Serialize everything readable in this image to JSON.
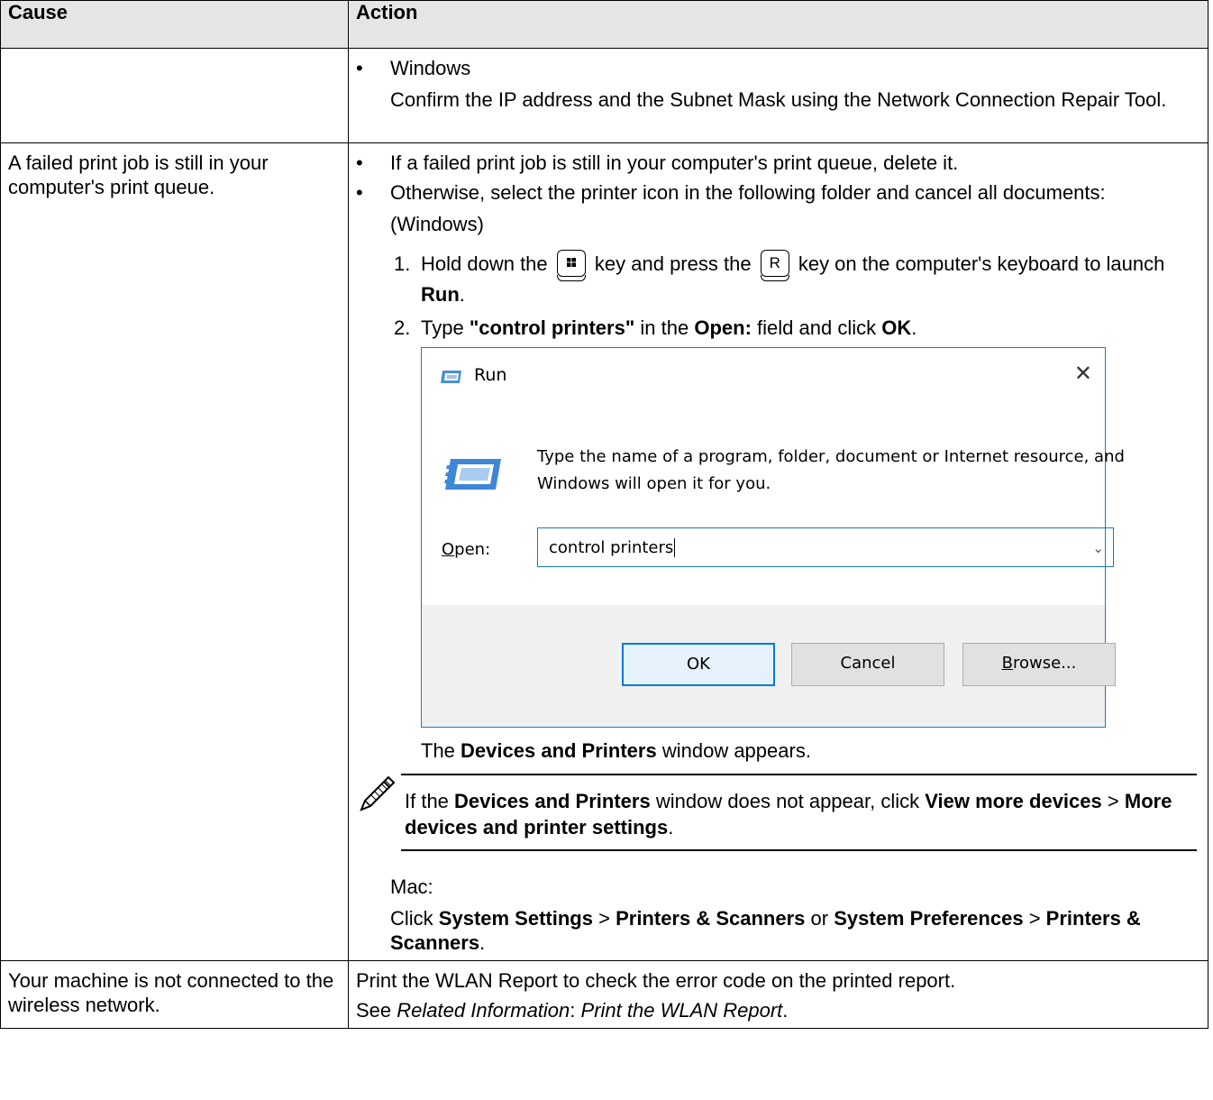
{
  "header": {
    "cause": "Cause",
    "action": "Action"
  },
  "row1": {
    "bullet": "Windows",
    "text": "Confirm the IP address and the Subnet Mask using the Network Connection Repair Tool."
  },
  "row2": {
    "cause": "A failed print job is still in your computer's print queue.",
    "bullet1": "If a failed print job is still in your computer's print queue, delete it.",
    "bullet2": "Otherwise, select the printer icon in the following folder and cancel all documents:",
    "windows_label": "(Windows)",
    "step1": {
      "num": "1.",
      "a": "Hold down the",
      "b": "key and press the",
      "key_r": "R",
      "c": "key on the computer's keyboard to launch",
      "run": "Run",
      "end": "."
    },
    "step2": {
      "num": "2.",
      "a": "Type",
      "cmd": "\"control printers\"",
      "b": "in the",
      "open": "Open:",
      "c": "field and click",
      "ok": "OK",
      "end": "."
    },
    "run_dialog": {
      "title": "Run",
      "close_glyph": "✕",
      "description": "Type the name of a program, folder, document or Internet resource, and Windows will open it for you.",
      "open_label_u": "O",
      "open_label_rest": "pen:",
      "input_value": "control printers",
      "ok_label": "OK",
      "cancel_label": "Cancel",
      "browse_u": "B",
      "browse_rest": "rowse..."
    },
    "appears": {
      "a": "The",
      "name": "Devices and Printers",
      "b": "window appears."
    },
    "note": {
      "a": "If the",
      "name": "Devices and Printers",
      "b": "window does not appear, click",
      "view": "View more devices",
      "gt": ">",
      "more": "More devices and printer settings",
      "end": "."
    },
    "mac_label": "Mac:",
    "mac": {
      "a": "Click",
      "sys": "System Settings",
      "gt1": ">",
      "ps1": "Printers & Scanners",
      "or": "or",
      "pref": "System Preferences",
      "gt2": ">",
      "ps2": "Printers & Scanners",
      "end": "."
    }
  },
  "row3": {
    "cause": "Your machine is not connected to the wireless network.",
    "line1": "Print the WLAN Report to check the error code on the printed report.",
    "see": "See",
    "related": "Related Information",
    "colon": ":",
    "link": "Print the WLAN Report",
    "end": "."
  },
  "icons": {
    "bullet": "•",
    "windows_key": "windows-logo",
    "pencil": "pencil-note"
  }
}
